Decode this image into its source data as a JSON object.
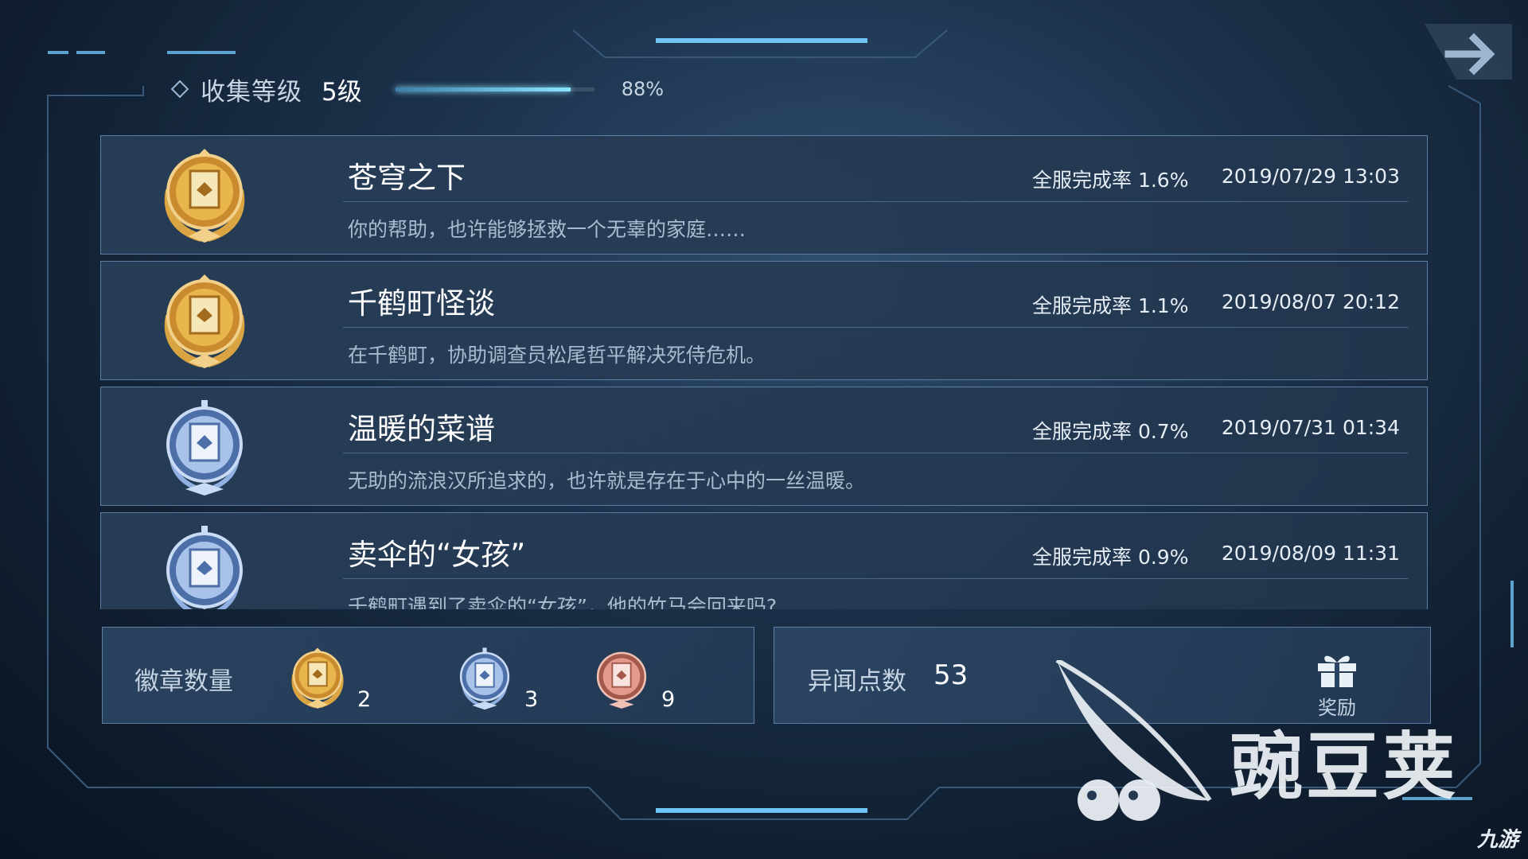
{
  "header": {
    "label": "收集等级",
    "level": "5级",
    "progress_percent": 88,
    "progress_text": "88%"
  },
  "achievements": [
    {
      "title": "苍穹之下",
      "rate": "全服完成率 1.6%",
      "date": "2019/07/29 13:03",
      "desc": "你的帮助，也许能够拯救一个无辜的家庭……",
      "badge": "gold"
    },
    {
      "title": "千鹤町怪谈",
      "rate": "全服完成率 1.1%",
      "date": "2019/08/07 20:12",
      "desc": "在千鹤町，协助调查员松尾哲平解决死侍危机。",
      "badge": "gold"
    },
    {
      "title": "温暖的菜谱",
      "rate": "全服完成率 0.7%",
      "date": "2019/07/31 01:34",
      "desc": "无助的流浪汉所追求的，也许就是存在于心中的一丝温暖。",
      "badge": "silver"
    },
    {
      "title": "卖伞的“女孩”",
      "rate": "全服完成率 0.9%",
      "date": "2019/08/09 11:31",
      "desc": "千鹤町遇到了卖伞的“女孩”，他的竹马会回来吗?",
      "badge": "silver"
    }
  ],
  "badges": {
    "label": "徽章数量",
    "gold_count": "2",
    "silver_count": "3",
    "bronze_count": "9"
  },
  "points": {
    "label": "异闻点数",
    "value": "53"
  },
  "reward": {
    "label": "奖励"
  },
  "watermark": {
    "text": "豌豆荚",
    "corner": "九游"
  },
  "colors": {
    "gold": "#e8b64c",
    "silver": "#a9c2ea",
    "bronze": "#e59a8e",
    "accent": "#6fc3f5"
  }
}
